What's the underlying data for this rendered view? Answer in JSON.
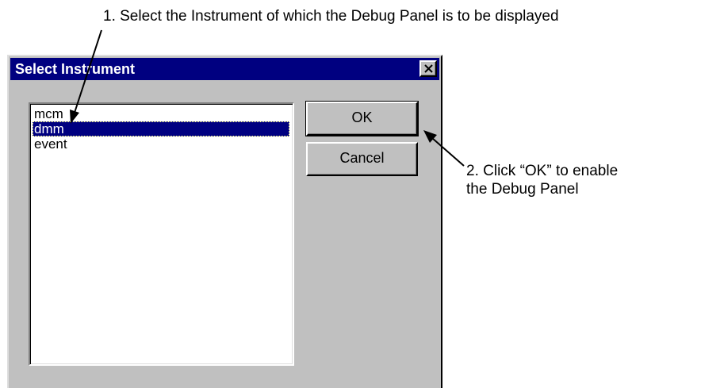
{
  "annotations": {
    "step1": "1. Select the Instrument of which the Debug Panel is to be displayed",
    "step2_line1": "2. Click “OK” to enable",
    "step2_line2": "the Debug Panel"
  },
  "dialog": {
    "title": "Select Instrument",
    "close_glyph": "close-icon",
    "instruments": [
      "mcm",
      "dmm",
      "event"
    ],
    "selected_instrument": "dmm",
    "ok_label": "OK",
    "cancel_label": "Cancel"
  },
  "colors": {
    "title_bar": "#000080",
    "dialog_face": "#c0c0c0",
    "selection": "#000080"
  }
}
